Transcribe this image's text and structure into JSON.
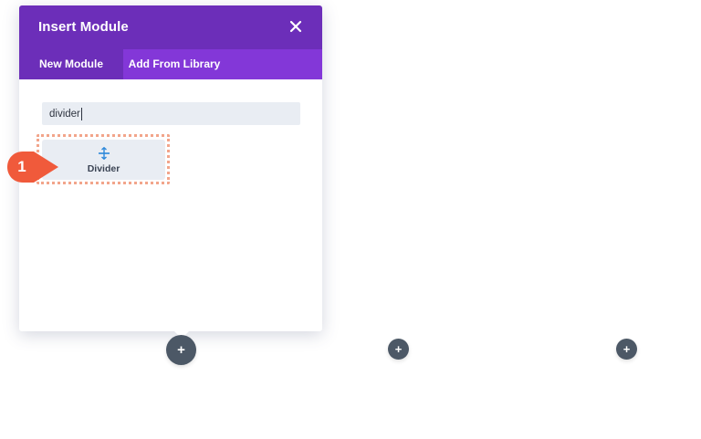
{
  "modal": {
    "title": "Insert Module",
    "close_icon": "close-icon",
    "tabs": [
      {
        "label": "New Module",
        "active": true
      },
      {
        "label": "Add From Library",
        "active": false
      }
    ],
    "search": {
      "value": "divider",
      "placeholder": ""
    },
    "modules": [
      {
        "label": "Divider",
        "icon": "divider-icon"
      }
    ]
  },
  "annotation": {
    "number": "1"
  },
  "add_buttons": {
    "symbol": "+"
  },
  "colors": {
    "header": "#6c2eb9",
    "tabs_bar": "#8337d8",
    "active_tab": "#6c2eb9",
    "module_bg": "#e9edf3",
    "highlight": "#f2a58b",
    "badge": "#f05a3b",
    "add_button": "#4c5866",
    "icon_blue": "#2b87da"
  }
}
